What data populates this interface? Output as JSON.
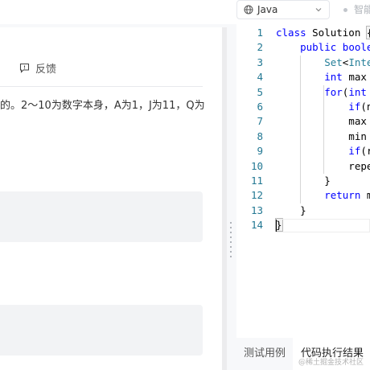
{
  "editor_header": {
    "language": "Java",
    "assistant_label": "智能"
  },
  "problem": {
    "feedback_label": "反馈",
    "description_fragment": "的。2～10为数字本身，A为1，J为11，Q为"
  },
  "code_lines": [
    {
      "n": "1",
      "tokens": [
        {
          "t": "class ",
          "c": "kw"
        },
        {
          "t": "Solution ",
          "c": ""
        },
        {
          "t": "{",
          "c": "brace-hl"
        }
      ]
    },
    {
      "n": "2",
      "tokens": [
        {
          "t": "    public ",
          "c": "kw"
        },
        {
          "t": "boolea",
          "c": "kw"
        }
      ]
    },
    {
      "n": "3",
      "tokens": [
        {
          "t": "        Set",
          "c": "ty"
        },
        {
          "t": "<",
          "c": ""
        },
        {
          "t": "Inte",
          "c": "ty"
        }
      ]
    },
    {
      "n": "4",
      "tokens": [
        {
          "t": "        int ",
          "c": "kw"
        },
        {
          "t": "max ",
          "c": ""
        }
      ]
    },
    {
      "n": "5",
      "tokens": [
        {
          "t": "        for",
          "c": "kw"
        },
        {
          "t": "(",
          "c": ""
        },
        {
          "t": "int ",
          "c": "kw"
        }
      ]
    },
    {
      "n": "6",
      "tokens": [
        {
          "t": "            if",
          "c": "kw"
        },
        {
          "t": "(n",
          "c": ""
        }
      ]
    },
    {
      "n": "7",
      "tokens": [
        {
          "t": "            max ",
          "c": ""
        }
      ]
    },
    {
      "n": "8",
      "tokens": [
        {
          "t": "            min ",
          "c": ""
        }
      ]
    },
    {
      "n": "9",
      "tokens": [
        {
          "t": "            if",
          "c": "kw"
        },
        {
          "t": "(r",
          "c": ""
        }
      ]
    },
    {
      "n": "10",
      "tokens": [
        {
          "t": "            repe",
          "c": ""
        }
      ]
    },
    {
      "n": "11",
      "tokens": [
        {
          "t": "        }",
          "c": ""
        }
      ]
    },
    {
      "n": "12",
      "tokens": [
        {
          "t": "        return ",
          "c": "kw"
        },
        {
          "t": "m",
          "c": ""
        }
      ]
    },
    {
      "n": "13",
      "tokens": [
        {
          "t": "    }",
          "c": ""
        }
      ]
    },
    {
      "n": "14",
      "tokens": [
        {
          "t": "}",
          "c": "brace-hl"
        }
      ]
    }
  ],
  "bottom_tabs": {
    "testcase_label": "测试用例",
    "result_label": "代码执行结果"
  },
  "watermark": "@稀土掘金技术社区",
  "colors": {
    "keyword": "#0000ff",
    "type": "#267f99",
    "line_number": "#237893"
  }
}
